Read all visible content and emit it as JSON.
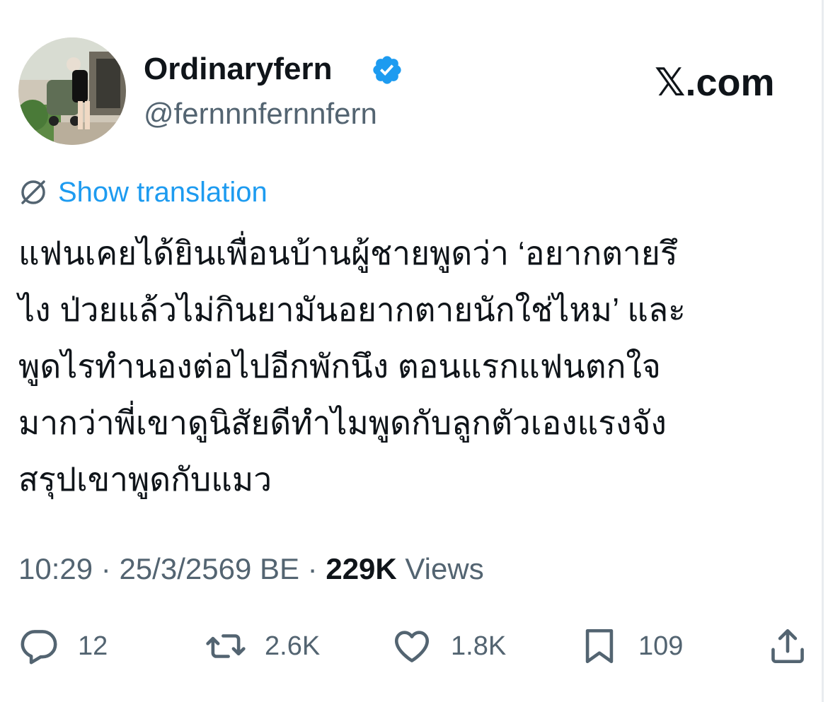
{
  "header": {
    "display_name": "Ordinaryfern",
    "handle": "@fernnnfernnfern",
    "brand": "𝕏.com"
  },
  "icons": {
    "avatar": "profile-photo",
    "verified": "verified-badge-icon",
    "translate": "globe-icon",
    "reply": "reply-icon",
    "retweet": "retweet-icon",
    "like": "heart-icon",
    "bookmark": "bookmark-icon",
    "share": "share-icon"
  },
  "colors": {
    "link": "#1d9bf0",
    "secondary_text": "#536471",
    "primary_text": "#0f1419"
  },
  "translate_label": "Show translation",
  "tweet": {
    "lines": [
      "แฟนเคยได้ยินเพื่อนบ้านผู้ชายพูดว่า ‘อยากตายรึ",
      "ไง ป่วยแล้วไม่กินยามันอยากตายนักใช่ไหม’ และ",
      "พูดไรทำนองต่อไปอีกพักนึง ตอนแรกแฟนตกใจ",
      "มากว่าพี่เขาดูนิสัยดีทำไมพูดกับลูกตัวเองแรงจัง",
      "สรุปเขาพูดกับแมว"
    ]
  },
  "meta": {
    "time": "10:29",
    "date": "25/3/2569 BE",
    "separator": "·",
    "views_count": "229K",
    "views_label": "Views"
  },
  "actions": {
    "replies": "12",
    "reposts": "2.6K",
    "likes": "1.8K",
    "bookmarks": "109"
  }
}
